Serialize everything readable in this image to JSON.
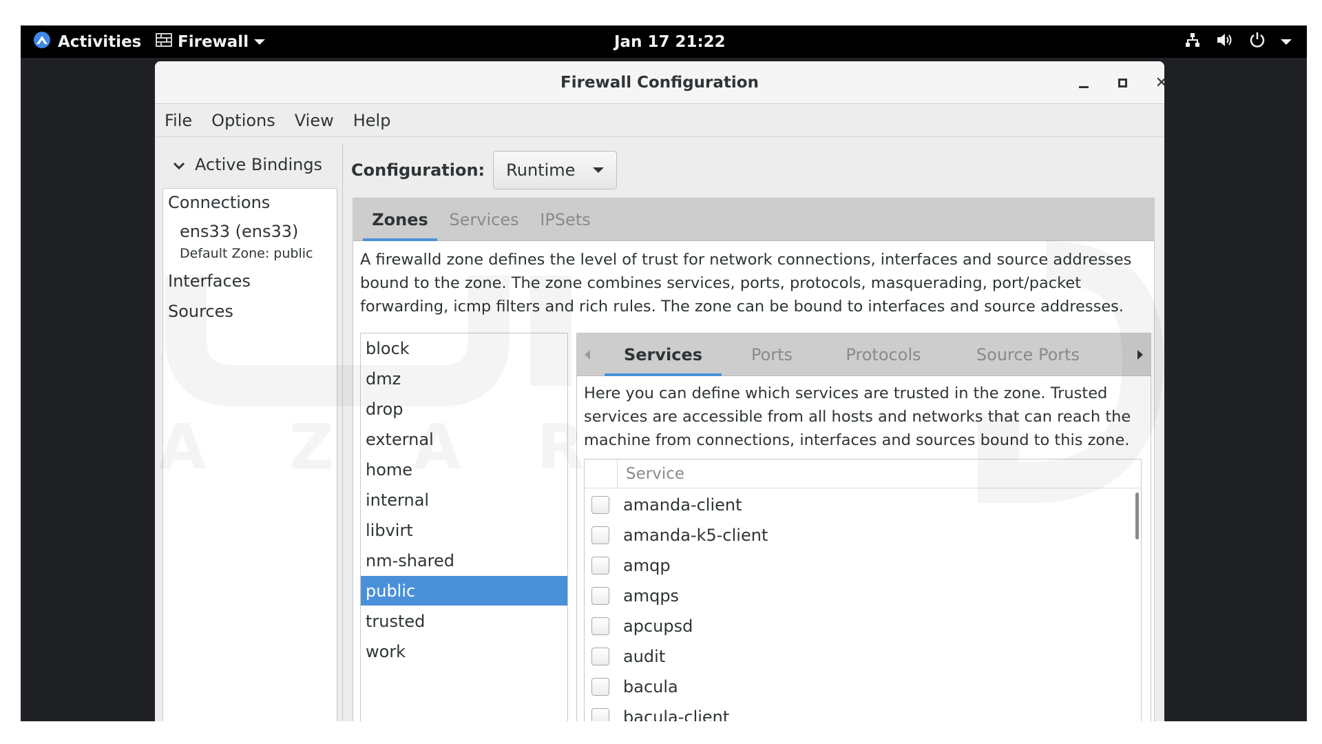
{
  "topbar": {
    "activities": "Activities",
    "app_menu": "Firewall",
    "clock": "Jan 17  21:22",
    "icons": [
      "network-icon",
      "volume-icon",
      "power-icon",
      "chevron-down-icon"
    ]
  },
  "window": {
    "title": "Firewall Configuration"
  },
  "menubar": {
    "items": [
      "File",
      "Options",
      "View",
      "Help"
    ]
  },
  "bindings": {
    "toggle_label": "Active Bindings",
    "connections_heading": "Connections",
    "connection_name": "ens33 (ens33)",
    "connection_zone": "Default Zone: public",
    "interfaces_heading": "Interfaces",
    "sources_heading": "Sources"
  },
  "configuration": {
    "label": "Configuration:",
    "value": "Runtime"
  },
  "main_tabs": {
    "items": [
      "Zones",
      "Services",
      "IPSets"
    ],
    "active": "Zones"
  },
  "zones": {
    "description": "A firewalld zone defines the level of trust for network connections, interfaces and source addresses bound to the zone. The zone combines services, ports, protocols, masquerading, port/packet forwarding, icmp filters and rich rules. The zone can be bound to interfaces and source addresses.",
    "items": [
      "block",
      "dmz",
      "drop",
      "external",
      "home",
      "internal",
      "libvirt",
      "nm-shared",
      "public",
      "trusted",
      "work"
    ],
    "selected": "public"
  },
  "zone_tabs": {
    "items": [
      "Services",
      "Ports",
      "Protocols",
      "Source Ports"
    ],
    "active": "Services"
  },
  "services": {
    "description": "Here you can define which services are trusted in the zone. Trusted services are accessible from all hosts and networks that can reach the machine from connections, interfaces and sources bound to this zone.",
    "column_header": "Service",
    "rows": [
      {
        "name": "amanda-client",
        "checked": false
      },
      {
        "name": "amanda-k5-client",
        "checked": false
      },
      {
        "name": "amqp",
        "checked": false
      },
      {
        "name": "amqps",
        "checked": false
      },
      {
        "name": "apcupsd",
        "checked": false
      },
      {
        "name": "audit",
        "checked": false
      },
      {
        "name": "bacula",
        "checked": false
      },
      {
        "name": "bacula-client",
        "checked": false
      }
    ]
  },
  "colors": {
    "accent": "#4a90d9",
    "topbar": "#000000",
    "window_bg": "#ededed"
  }
}
